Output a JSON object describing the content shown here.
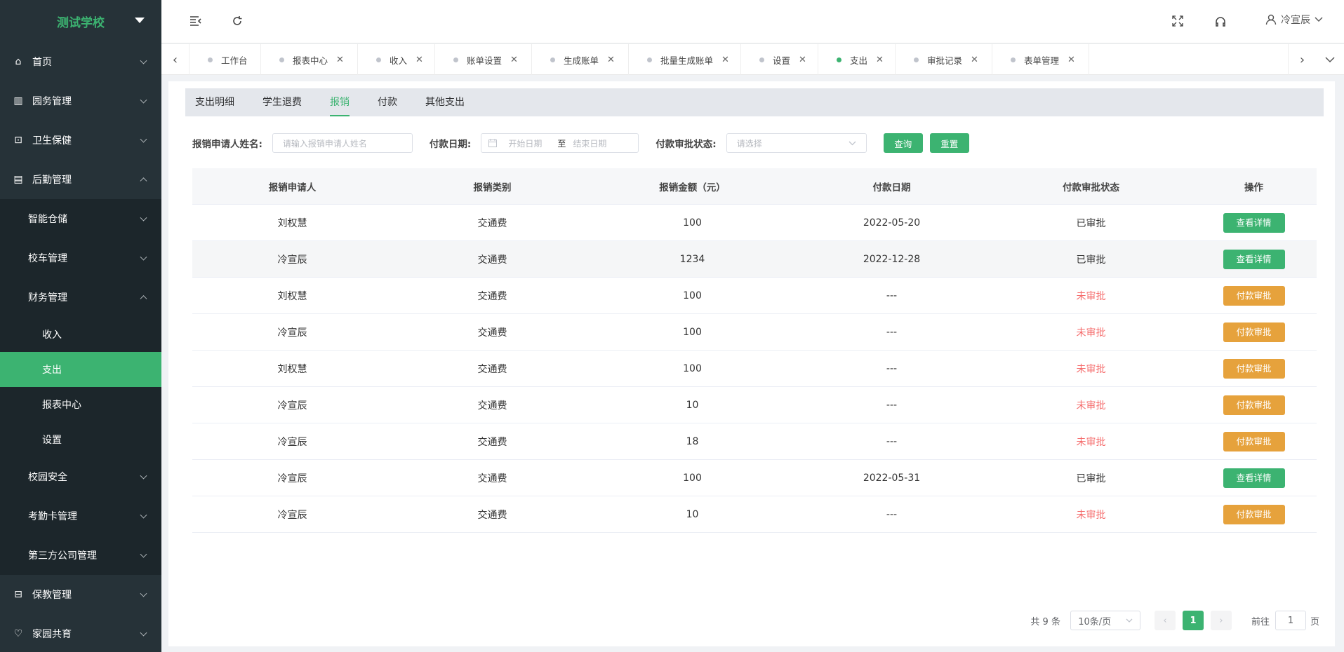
{
  "sidebar": {
    "brand": "测试学校",
    "items": [
      {
        "label": "首页",
        "icon": "home-icon"
      },
      {
        "label": "园务管理",
        "icon": "building-icon"
      },
      {
        "label": "卫生保健",
        "icon": "health-icon"
      },
      {
        "label": "后勤管理",
        "icon": "logistics-icon"
      }
    ],
    "logistics_sub": [
      "智能仓储",
      "校车管理",
      "财务管理"
    ],
    "finance_sub": [
      "收入",
      "支出",
      "报表中心",
      "设置"
    ],
    "logistics_more": [
      "校园安全",
      "考勤卡管理",
      "第三方公司管理"
    ],
    "bottom": [
      {
        "label": "保教管理",
        "icon": "teaching-icon"
      },
      {
        "label": "家园共育",
        "icon": "family-icon"
      }
    ]
  },
  "header": {
    "user": "冷宣辰"
  },
  "tags": [
    {
      "label": "工作台",
      "closable": false
    },
    {
      "label": "报表中心",
      "closable": true
    },
    {
      "label": "收入",
      "closable": true
    },
    {
      "label": "账单设置",
      "closable": true
    },
    {
      "label": "生成账单",
      "closable": true
    },
    {
      "label": "批量生成账单",
      "closable": true
    },
    {
      "label": "设置",
      "closable": true
    },
    {
      "label": "支出",
      "closable": true
    },
    {
      "label": "审批记录",
      "closable": true
    },
    {
      "label": "表单管理",
      "closable": true
    }
  ],
  "subtabs": [
    "支出明细",
    "学生退费",
    "报销",
    "付款",
    "其他支出"
  ],
  "filters": {
    "name_label": "报销申请人姓名:",
    "name_placeholder": "请输入报销申请人姓名",
    "date_label": "付款日期:",
    "start_placeholder": "开始日期",
    "to": "至",
    "end_placeholder": "结束日期",
    "status_label": "付款审批状态:",
    "status_placeholder": "请选择",
    "query": "查询",
    "reset": "重置"
  },
  "table": {
    "headers": [
      "报销申请人",
      "报销类别",
      "报销金额（元）",
      "付款日期",
      "付款审批状态",
      "操作"
    ],
    "rows": [
      {
        "name": "刘权慧",
        "type": "交通费",
        "amount": "100",
        "date": "2022-05-20",
        "status": "已审批",
        "action": "查看详情"
      },
      {
        "name": "冷宣辰",
        "type": "交通费",
        "amount": "1234",
        "date": "2022-12-28",
        "status": "已审批",
        "action": "查看详情"
      },
      {
        "name": "刘权慧",
        "type": "交通费",
        "amount": "100",
        "date": "---",
        "status": "未审批",
        "action": "付款审批"
      },
      {
        "name": "冷宣辰",
        "type": "交通费",
        "amount": "100",
        "date": "---",
        "status": "未审批",
        "action": "付款审批"
      },
      {
        "name": "刘权慧",
        "type": "交通费",
        "amount": "100",
        "date": "---",
        "status": "未审批",
        "action": "付款审批"
      },
      {
        "name": "冷宣辰",
        "type": "交通费",
        "amount": "10",
        "date": "---",
        "status": "未审批",
        "action": "付款审批"
      },
      {
        "name": "冷宣辰",
        "type": "交通费",
        "amount": "18",
        "date": "---",
        "status": "未审批",
        "action": "付款审批"
      },
      {
        "name": "冷宣辰",
        "type": "交通费",
        "amount": "100",
        "date": "2022-05-31",
        "status": "已审批",
        "action": "查看详情"
      },
      {
        "name": "冷宣辰",
        "type": "交通费",
        "amount": "10",
        "date": "---",
        "status": "未审批",
        "action": "付款审批"
      }
    ]
  },
  "pager": {
    "total": "共 9 条",
    "size": "10条/页",
    "page": "1",
    "goto": "前往",
    "goto_value": "1",
    "page_suffix": "页"
  },
  "colors": {
    "accent": "#3cb371",
    "warning": "#e6a23c",
    "danger": "#f56c6c",
    "sidebar": "#263238"
  }
}
